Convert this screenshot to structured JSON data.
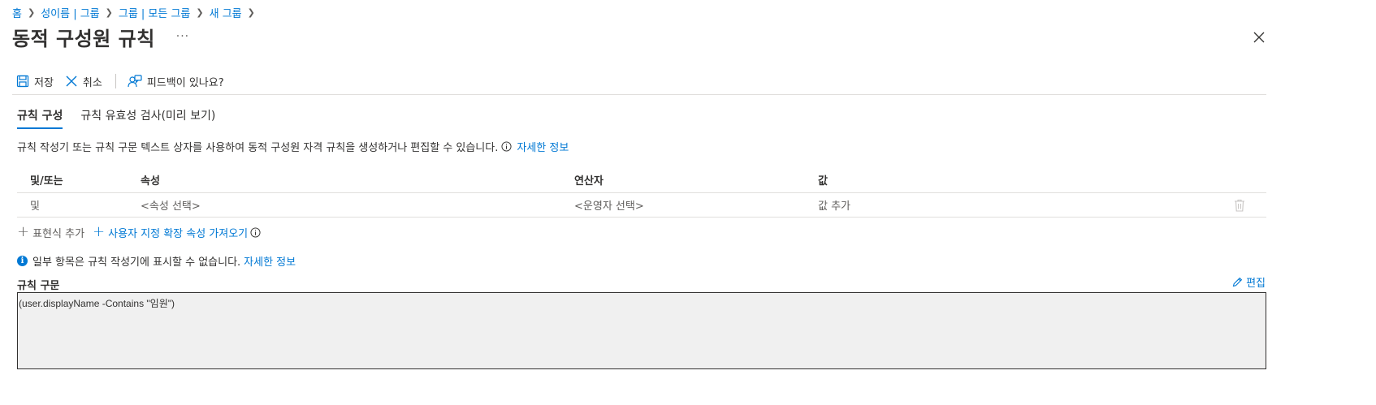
{
  "breadcrumb": [
    {
      "label": "홈"
    },
    {
      "label": "성이름 | 그룹"
    },
    {
      "label": "그룹 | 모든 그룹"
    },
    {
      "label": "새 그룹"
    }
  ],
  "page": {
    "title": "동적 구성원 규칙",
    "more": "···"
  },
  "toolbar": {
    "save": "저장",
    "cancel": "취소",
    "feedback": "피드백이 있나요?"
  },
  "tabs": [
    {
      "label": "규칙 구성",
      "active": true
    },
    {
      "label": "규칙 유효성 검사(미리 보기)",
      "active": false
    }
  ],
  "description": {
    "text": "규칙 작성기 또는 규칙 구문 텍스트 상자를 사용하여 동적 구성원 자격 규칙을 생성하거나 편집할 수 있습니다.",
    "link": "자세한 정보"
  },
  "grid": {
    "headers": [
      "및/또는",
      "속성",
      "연산자",
      "값"
    ],
    "rows": [
      {
        "andor": "및",
        "property": "<속성 선택>",
        "operator": "<운영자 선택>",
        "value": "값 추가"
      }
    ]
  },
  "actions": {
    "add_expression": "표현식 추가",
    "get_custom_ext": "사용자 지정 확장 속성 가져오기"
  },
  "notice": {
    "text": "일부 항목은 규칙 작성기에 표시할 수 없습니다.",
    "link": "자세한 정보"
  },
  "syntax": {
    "label": "규칙 구문",
    "edit": "편집",
    "value": "(user.displayName -Contains \"임원\")"
  },
  "colors": {
    "accent": "#0078d4",
    "text": "#323130",
    "muted": "#605e5c",
    "divider": "#e1dfdd",
    "syntax_bg": "#f0f0f0"
  }
}
